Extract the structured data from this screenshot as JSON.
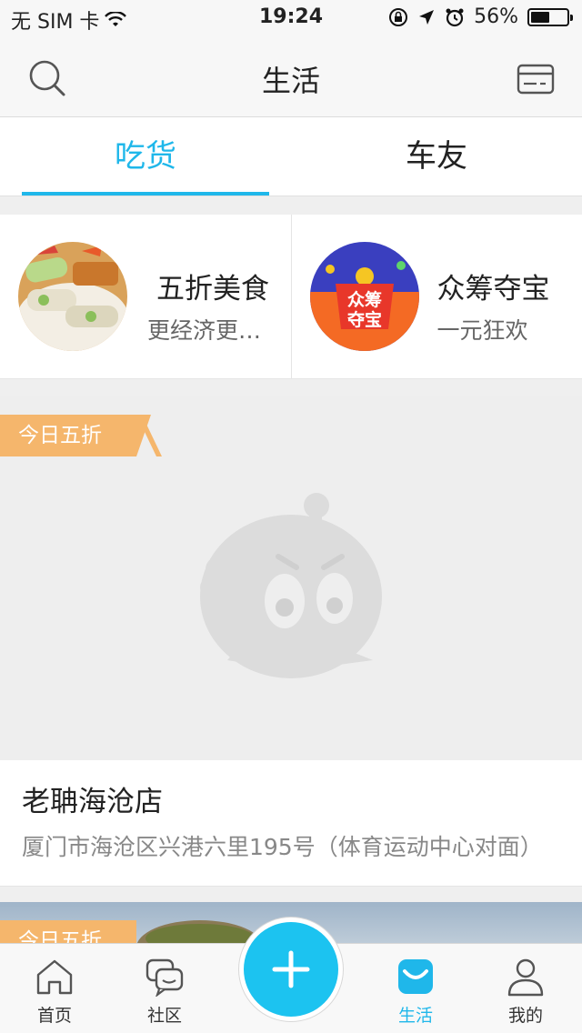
{
  "status_bar": {
    "carrier": "无 SIM 卡",
    "time": "19:24",
    "battery": "56%",
    "battery_level": 0.56
  },
  "nav": {
    "title": "生活",
    "left_icon": "search-icon",
    "right_icon": "card-icon"
  },
  "tabs": [
    {
      "label": "吃货",
      "active": true
    },
    {
      "label": "车友",
      "active": false
    }
  ],
  "promos": [
    {
      "title": "五折美食",
      "subtitle": "更经济更…",
      "thumb_text": ""
    },
    {
      "title": "众筹夺宝",
      "subtitle": "一元狂欢",
      "thumb_text": "众筹\n夺宝"
    }
  ],
  "stores": [
    {
      "badge": "今日五折",
      "name": "老聃海沧店",
      "address": "厦门市海沧区兴港六里195号（体育运动中心对面）"
    },
    {
      "badge": "今日五折"
    }
  ],
  "tabbar": [
    {
      "label": "首页",
      "icon": "home-icon",
      "active": false
    },
    {
      "label": "社区",
      "icon": "chat-icon",
      "active": false
    },
    {
      "label": "",
      "icon": "plus-icon",
      "active": false
    },
    {
      "label": "生活",
      "icon": "life-icon",
      "active": true
    },
    {
      "label": "我的",
      "icon": "user-icon",
      "active": false
    }
  ],
  "colors": {
    "accent": "#1fb7ea",
    "badge": "#f5b66c",
    "plus": "#1cc3f0"
  }
}
